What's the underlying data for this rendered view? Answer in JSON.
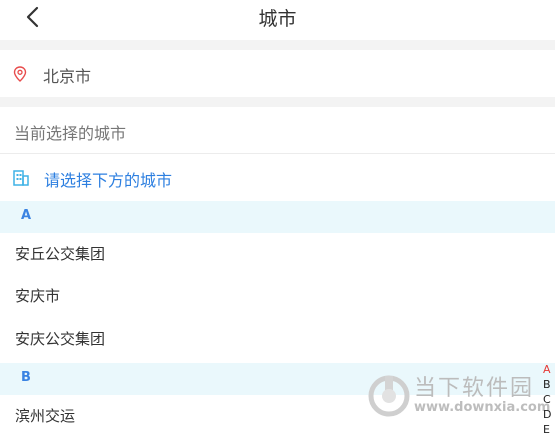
{
  "header": {
    "title": "城市"
  },
  "location": {
    "city": "北京市"
  },
  "current": {
    "label": "当前选择的城市"
  },
  "select_prompt": {
    "text": "请选择下方的城市"
  },
  "sections": [
    {
      "letter": "A",
      "items": [
        "安丘公交集团",
        "安庆市",
        "安庆公交集团"
      ]
    },
    {
      "letter": "B",
      "items": [
        "滨州交运"
      ]
    }
  ],
  "index_letters": [
    "A",
    "B",
    "C",
    "D",
    "E"
  ],
  "watermark": {
    "name": "当下软件园",
    "url": "www.downxia.com"
  },
  "colors": {
    "accent_blue": "#2d7fe0",
    "section_bg": "#eaf8fc",
    "index_active": "#e53935",
    "pin_red": "#e84c4c"
  }
}
